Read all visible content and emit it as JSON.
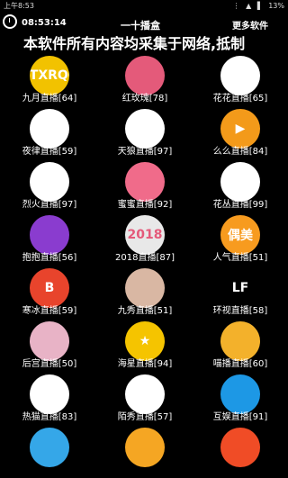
{
  "status": {
    "time": "上午8:53",
    "battery": "13%"
  },
  "appbar": {
    "clock_time": "08:53:14",
    "title": "一十播盒",
    "more_label": "更多软件"
  },
  "marquee": "本软件所有内容均采集于网络,抵制",
  "colors": {
    "background": "#000000",
    "text": "#ffffff"
  },
  "grid": [
    {
      "label": "九月直播[64]",
      "icon": "logo-icon",
      "icon_text": "STXRQG",
      "bg": "#f2c200"
    },
    {
      "label": "红玫瑰[78]",
      "icon": "rose-icon",
      "icon_text": "",
      "bg": "#e45a7a"
    },
    {
      "label": "花花直播[65]",
      "icon": "face-icon",
      "icon_text": "",
      "bg": "#ffffff"
    },
    {
      "label": "夜律直播[59]",
      "icon": "dancer-icon",
      "icon_text": "",
      "bg": "#ffffff"
    },
    {
      "label": "天狼直播[97]",
      "icon": "wolf-icon",
      "icon_text": "",
      "bg": "#ffffff"
    },
    {
      "label": "么么直播[84]",
      "icon": "play-icon",
      "icon_text": "▶",
      "bg": "#f39a1a"
    },
    {
      "label": "烈火直播[97]",
      "icon": "feather-icon",
      "icon_text": "",
      "bg": "#ffffff"
    },
    {
      "label": "蜜蜜直播[92]",
      "icon": "bunny-icon",
      "icon_text": "",
      "bg": "#f06b8a"
    },
    {
      "label": "花丛直播[99]",
      "icon": "leaf-icon",
      "icon_text": "",
      "bg": "#ffffff"
    },
    {
      "label": "抱抱直播[56]",
      "icon": "circle-icon",
      "icon_text": "",
      "bg": "#8a3ccf"
    },
    {
      "label": "2018直播[87]",
      "icon": "year-icon",
      "icon_text": "2018",
      "bg": "#e8e8e8"
    },
    {
      "label": "人气直播[51]",
      "icon": "popular-icon",
      "icon_text": "偶美",
      "bg": "#f79b1f"
    },
    {
      "label": "寒冰直播[59]",
      "icon": "letter-b-icon",
      "icon_text": "B",
      "bg": "#e8442c"
    },
    {
      "label": "九秀直播[51]",
      "icon": "portrait-icon",
      "icon_text": "",
      "bg": "#d9b7a3"
    },
    {
      "label": "环视直播[58]",
      "icon": "lf-icon",
      "icon_text": "LF",
      "bg": "#000000"
    },
    {
      "label": "后宫直播[50]",
      "icon": "girl-icon",
      "icon_text": "",
      "bg": "#e8b3c6"
    },
    {
      "label": "海星直播[94]",
      "icon": "star-icon",
      "icon_text": "★",
      "bg": "#f5c400"
    },
    {
      "label": "喵播直播[60]",
      "icon": "cat-icon",
      "icon_text": "",
      "bg": "#f3b12b"
    },
    {
      "label": "热猫直播[83]",
      "icon": "hot-cat-icon",
      "icon_text": "",
      "bg": "#ffffff"
    },
    {
      "label": "陌秀直播[57]",
      "icon": "bow-icon",
      "icon_text": "",
      "bg": "#ffffff"
    },
    {
      "label": "互娱直播[91]",
      "icon": "dolphin-icon",
      "icon_text": "",
      "bg": "#1d98e5"
    },
    {
      "label": "",
      "icon": "app-icon",
      "icon_text": "",
      "bg": "#35a7e8"
    },
    {
      "label": "",
      "icon": "app-icon",
      "icon_text": "",
      "bg": "#f5a623"
    },
    {
      "label": "",
      "icon": "flame-icon",
      "icon_text": "",
      "bg": "#f04c26"
    }
  ]
}
